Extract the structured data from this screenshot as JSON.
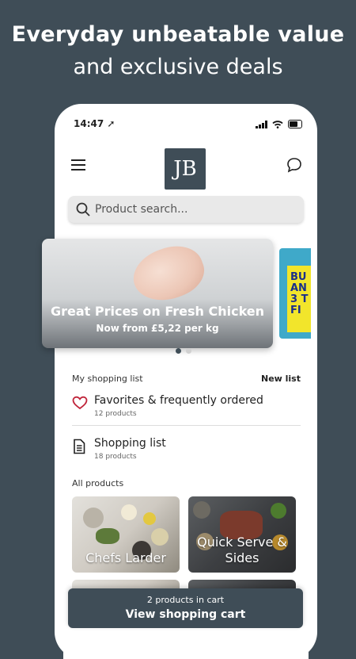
{
  "promo": {
    "line1": "Everyday unbeatable value",
    "line2": "and exclusive deals"
  },
  "status": {
    "time": "14:47"
  },
  "header": {
    "logo_text": "JB"
  },
  "search": {
    "placeholder": "Product search..."
  },
  "banner": {
    "title": "Great Prices on Fresh Chicken",
    "subtitle": "Now from £5,22 per kg",
    "next_partial_text": "BU\nAN\n3 T\nFI"
  },
  "shopping_list": {
    "heading": "My shopping list",
    "new_label": "New list",
    "items": [
      {
        "label": "Favorites & frequently ordered",
        "count": "12 products"
      },
      {
        "label": "Shopping list",
        "count": "18 products"
      }
    ]
  },
  "all_products": {
    "heading": "All products",
    "tiles": [
      {
        "label": "Chefs Larder"
      },
      {
        "label": "Quick Serve & Sides"
      }
    ]
  },
  "cart": {
    "count_text": "2 products in cart",
    "cta": "View shopping cart"
  },
  "colors": {
    "brand": "#3f4d57",
    "heart": "#c0243a"
  }
}
